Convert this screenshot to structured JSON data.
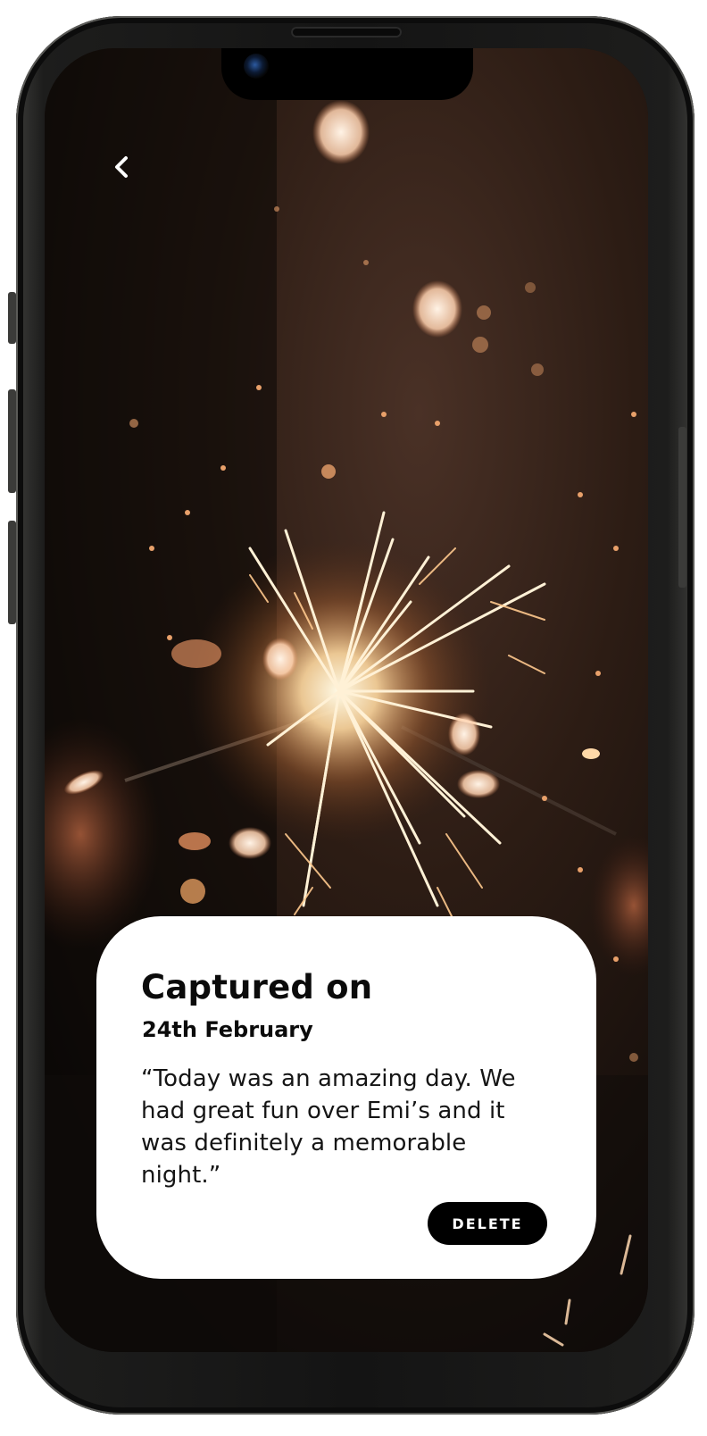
{
  "nav": {
    "back_icon": "chevron-left-icon"
  },
  "memory_card": {
    "title": "Captured on",
    "date": "24th February",
    "note": "“Today was an amazing day. We had great fun over Emi’s and it was definitely a memorable night.”",
    "delete_label": "DELETE"
  },
  "photo": {
    "subject": "sparkler-photo"
  },
  "colors": {
    "card_background": "#ffffff",
    "button_background": "#000000",
    "button_text": "#ffffff",
    "text_primary": "#0b0b0b"
  }
}
